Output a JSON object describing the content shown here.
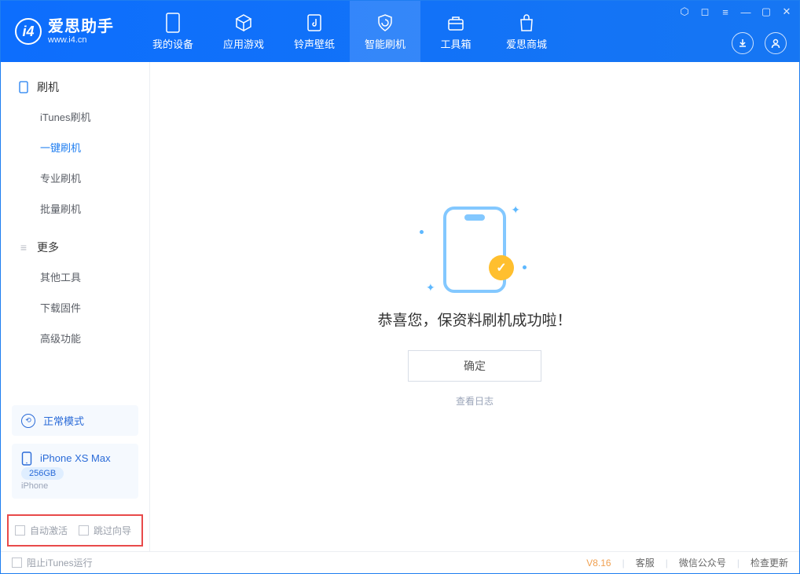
{
  "app": {
    "name_cn": "爱思助手",
    "name_en": "www.i4.cn"
  },
  "tabs": [
    {
      "label": "我的设备"
    },
    {
      "label": "应用游戏"
    },
    {
      "label": "铃声壁纸"
    },
    {
      "label": "智能刷机"
    },
    {
      "label": "工具箱"
    },
    {
      "label": "爱思商城"
    }
  ],
  "sidebar": {
    "sections": {
      "flash": {
        "title": "刷机",
        "items": [
          "iTunes刷机",
          "一键刷机",
          "专业刷机",
          "批量刷机"
        ]
      },
      "more": {
        "title": "更多",
        "items": [
          "其他工具",
          "下载固件",
          "高级功能"
        ]
      }
    },
    "mode_label": "正常模式",
    "device": {
      "name": "iPhone XS Max",
      "capacity": "256GB",
      "type": "iPhone"
    },
    "checkboxes": {
      "auto_activate": "自动激活",
      "skip_guide": "跳过向导"
    }
  },
  "main": {
    "success_title": "恭喜您，保资料刷机成功啦！",
    "ok_label": "确定",
    "view_log": "查看日志"
  },
  "footer": {
    "block_itunes": "阻止iTunes运行",
    "version": "V8.16",
    "links": [
      "客服",
      "微信公众号",
      "检查更新"
    ]
  }
}
